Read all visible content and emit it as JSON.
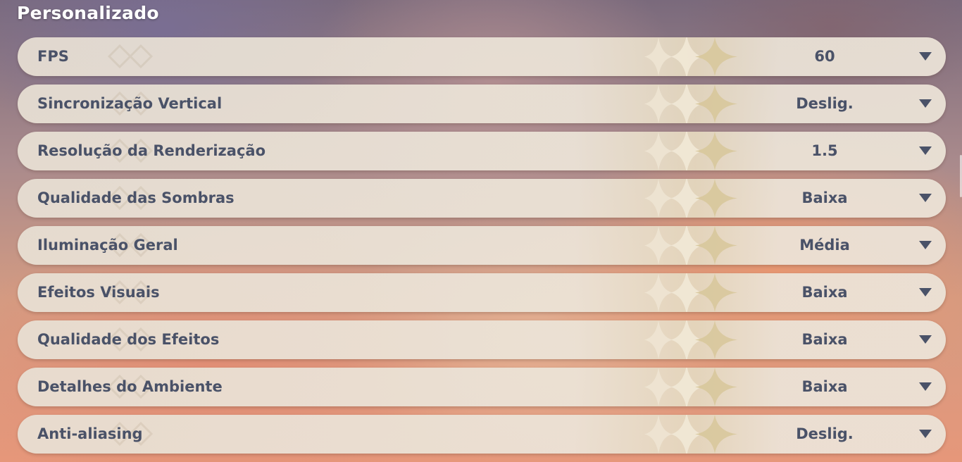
{
  "section": {
    "title": "Personalizado"
  },
  "settings": [
    {
      "label": "FPS",
      "value": "60"
    },
    {
      "label": "Sincronização Vertical",
      "value": "Deslig."
    },
    {
      "label": "Resolução da Renderização",
      "value": "1.5"
    },
    {
      "label": "Qualidade das Sombras",
      "value": "Baixa"
    },
    {
      "label": "Iluminação Geral",
      "value": "Média"
    },
    {
      "label": "Efeitos Visuais",
      "value": "Baixa"
    },
    {
      "label": "Qualidade dos Efeitos",
      "value": "Baixa"
    },
    {
      "label": "Detalhes do Ambiente",
      "value": "Baixa"
    },
    {
      "label": "Anti-aliasing",
      "value": "Deslig."
    }
  ],
  "icons": {
    "dropdown": "chevron-down-icon",
    "decoration": "star-sparkle-icon"
  },
  "colors": {
    "text": "#4a5268",
    "row_background": "#ece4d8",
    "sparkle": "#d8c79a",
    "title": "#ffffff"
  }
}
